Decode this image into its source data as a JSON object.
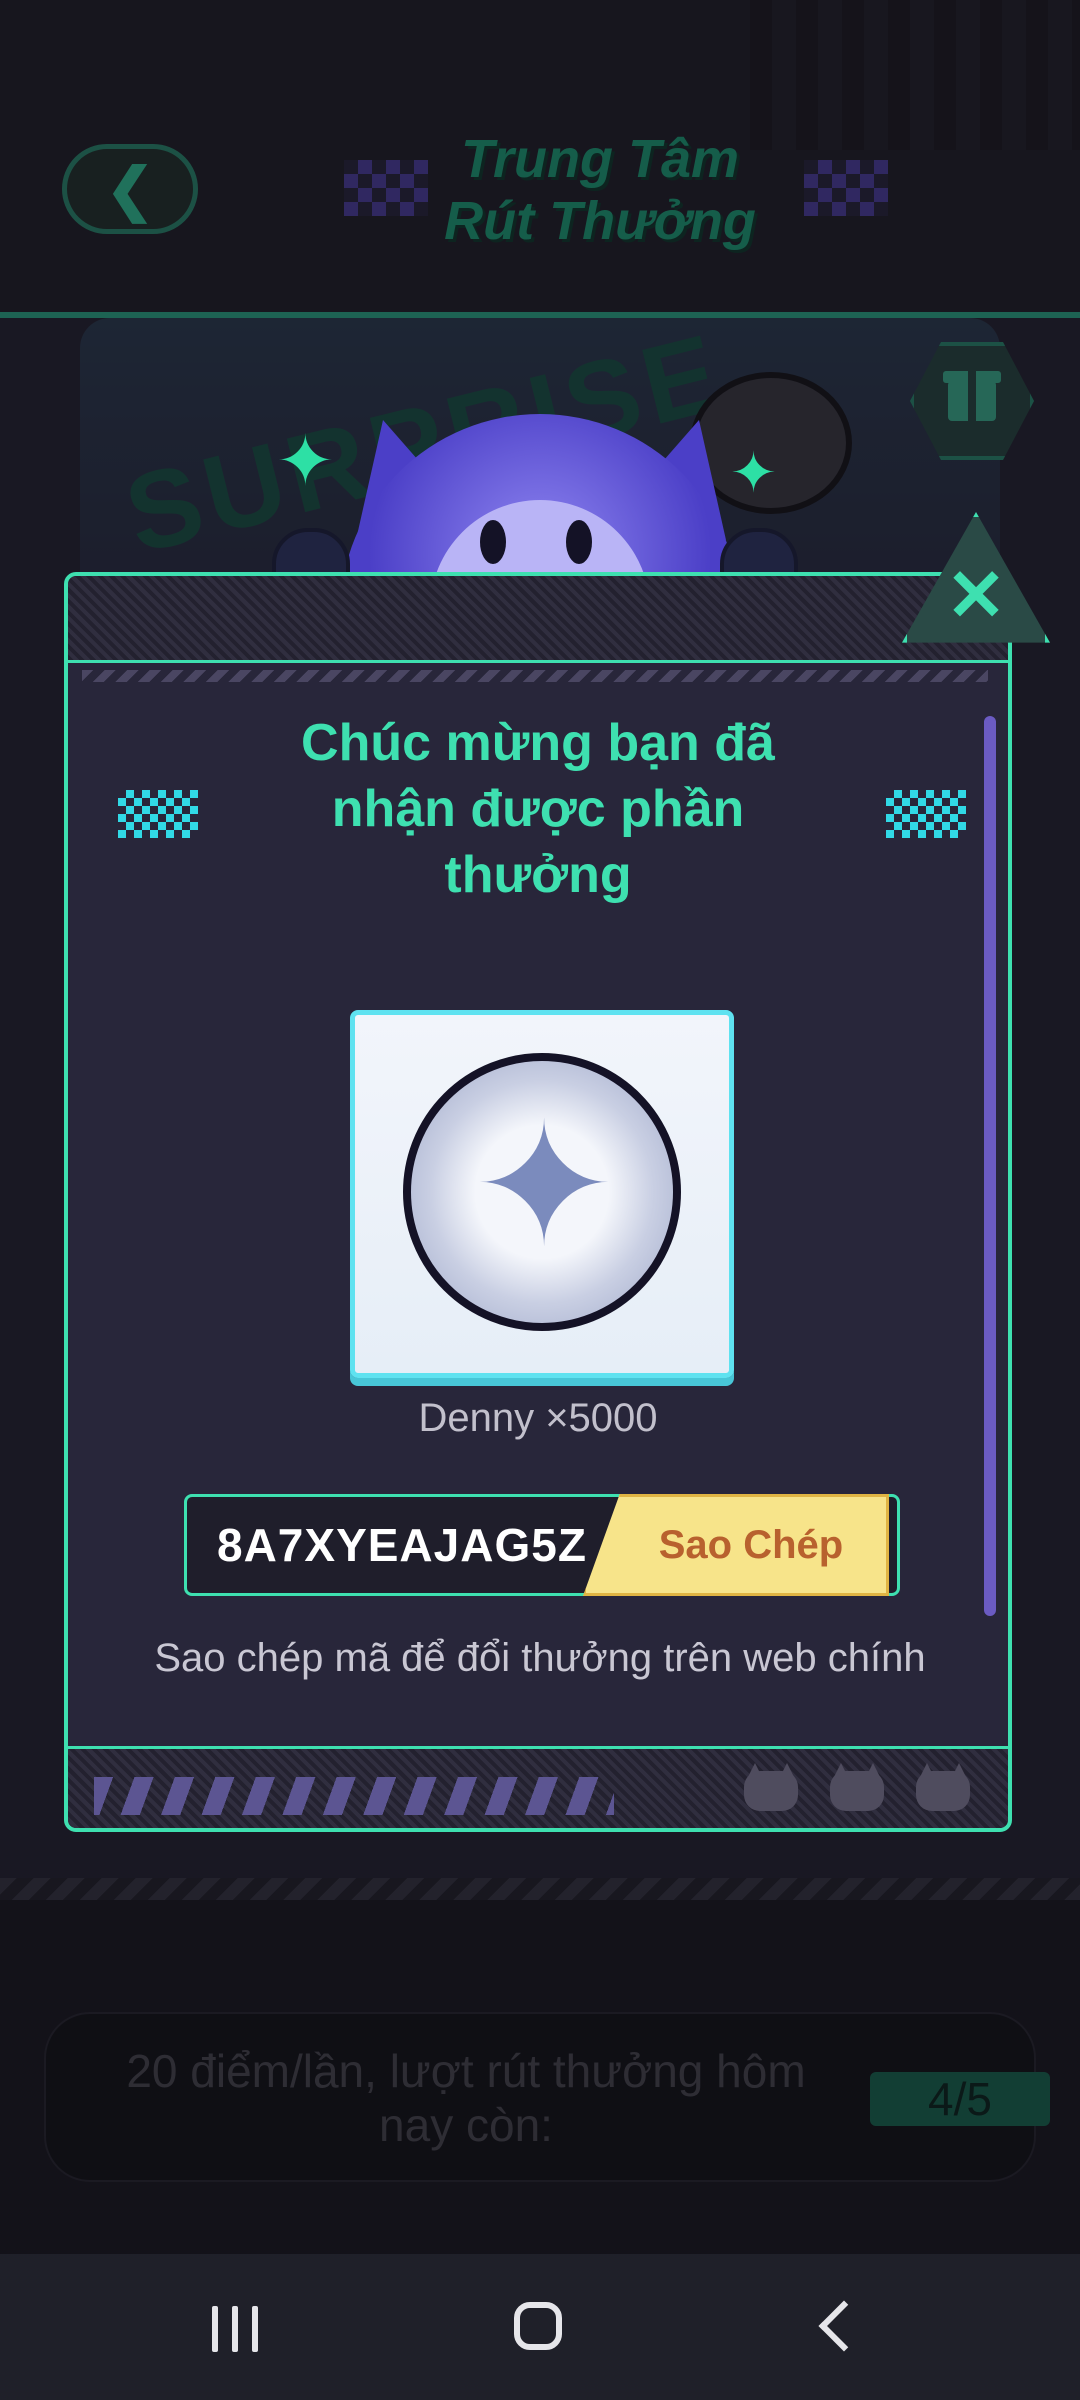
{
  "header": {
    "title": "Trung Tâm\nRút Thưởng",
    "back_icon": "back-arrow-icon"
  },
  "background": {
    "banner_text": "SURPRISE",
    "gift_icon": "gift-icon"
  },
  "modal": {
    "title": "Chúc mừng bạn đã nhận được phần thưởng",
    "reward_name": "Denny ×5000",
    "reward_icon": "coin-icon",
    "code": "8A7XYEAJAG5Z",
    "copy_label": "Sao Chép",
    "hint": "Sao chép mã để đổi thưởng trên web chính",
    "close_icon": "close-icon",
    "accent_color": "#3ee0b0"
  },
  "footer": {
    "info_text": "20 điểm/lần, lượt rút thưởng hôm nay còn:",
    "remaining": "4/5"
  },
  "system_nav": {
    "recent_icon": "recent-apps-icon",
    "home_icon": "home-icon",
    "back_icon": "back-icon"
  }
}
